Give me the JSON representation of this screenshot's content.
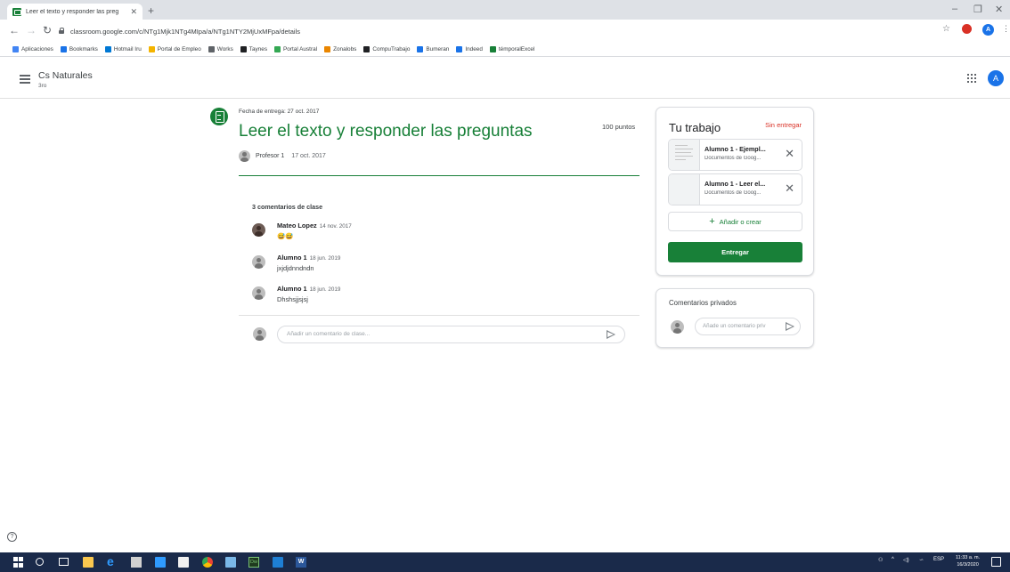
{
  "browser": {
    "tab_title": "Leer el texto y responder las preg",
    "url": "classroom.google.com/c/NTg1Mjk1NTg4MIpa/a/NTg1NTY2MjUxMFpa/details",
    "new_tab_icon": "plus-icon",
    "profile_initial": "A",
    "bookmarks": [
      {
        "label": "Aplicaciones",
        "icon": "apps-icon",
        "color": "#4285f4"
      },
      {
        "label": "Bookmarks",
        "icon": "star-icon",
        "color": "#1a73e8"
      },
      {
        "label": "Hotmail Iru",
        "icon": "outlook-icon",
        "color": "#0078d4"
      },
      {
        "label": "Portal de Empleo",
        "icon": "bubble-icon",
        "color": "#f4b400"
      },
      {
        "label": "Works",
        "icon": "globe-icon",
        "color": "#5f6368"
      },
      {
        "label": "Taynes",
        "icon": "circle-icon",
        "color": "#202124"
      },
      {
        "label": "Portal Austral",
        "icon": "dots-icon",
        "color": "#34a853"
      },
      {
        "label": "Zonalobs",
        "icon": "zonajobs-icon",
        "color": "#ea8600"
      },
      {
        "label": "CompuTrabajo",
        "icon": "ct-icon",
        "color": "#202124"
      },
      {
        "label": "Bumeran",
        "icon": "b-icon",
        "color": "#1a73e8"
      },
      {
        "label": "Indeed",
        "icon": "indeed-icon",
        "color": "#1a73e8"
      },
      {
        "label": "témporalExcel",
        "icon": "refresh-icon",
        "color": "#188038"
      }
    ]
  },
  "header": {
    "course_title": "Cs Naturales",
    "course_section": "3ro",
    "avatar_initial": "A"
  },
  "assignment": {
    "due": "Fecha de entrega: 27 oct. 2017",
    "title": "Leer el texto y responder las preguntas",
    "points": "100 puntos",
    "teacher": "Profesor 1",
    "posted": "17 oct. 2017"
  },
  "comments": {
    "header": "3 comentarios de clase",
    "items": [
      {
        "author": "Mateo Lopez",
        "date": "14 nov. 2017",
        "text": "😅😅"
      },
      {
        "author": "Alumno 1",
        "date": "18 jun. 2019",
        "text": "jxjdjdnndndn"
      },
      {
        "author": "Alumno 1",
        "date": "18 jun. 2019",
        "text": "Dhshsjjsjsj"
      }
    ],
    "add_placeholder": "Añadir un comentario de clase..."
  },
  "work": {
    "title": "Tu trabajo",
    "status": "Sin entregar",
    "status_color": "#d93025",
    "attachments": [
      {
        "title": "Alumno 1 - Ejempl...",
        "subtitle": "Documentos de Goog..."
      },
      {
        "title": "Alumno 1 - Leer el...",
        "subtitle": "Documentos de Goog..."
      }
    ],
    "add_label": "Añadir o crear",
    "turn_in_label": "Entregar",
    "accent": "#188038"
  },
  "private_comments": {
    "title": "Comentarios privados",
    "placeholder": "Añade un comentario priv"
  },
  "taskbar": {
    "language": "ESP",
    "time": "11:33 a. m.",
    "date": "16/3/2020"
  }
}
